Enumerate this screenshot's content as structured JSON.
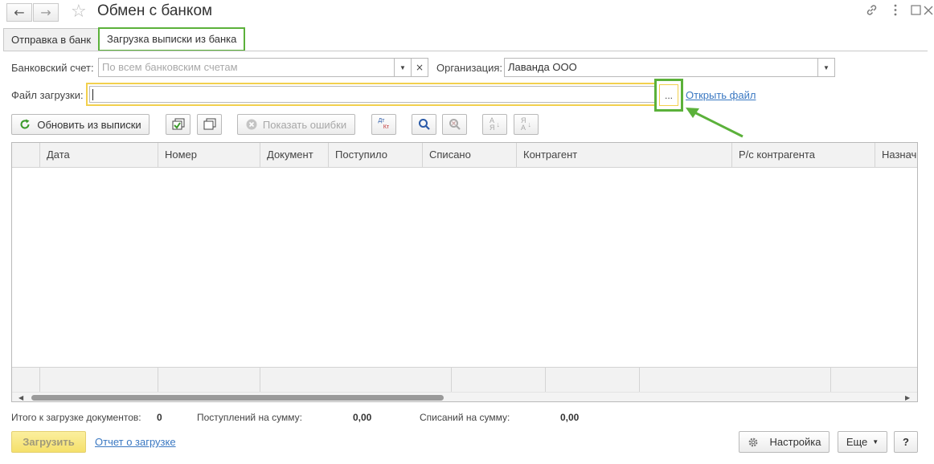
{
  "window": {
    "title": "Обмен с банком",
    "back_icon": "←",
    "forward_icon": "→",
    "favorite_icon": "☆",
    "link_icon": "🔗",
    "more_icon": "⋮",
    "maximize_icon": "□",
    "close_icon": "✕"
  },
  "tabs": [
    {
      "label": "Отправка в банк"
    },
    {
      "label": "Загрузка выписки из банка"
    }
  ],
  "form": {
    "bank_account_label": "Банковский счет:",
    "bank_account_placeholder": "По всем банковским счетам",
    "organization_label": "Организация:",
    "organization_value": "Лаванда ООО",
    "file_label": "Файл загрузки:",
    "file_value": "",
    "select_file_button": "...",
    "open_file_link": "Открыть файл",
    "dropdown_icon": "▼",
    "clear_icon": "×"
  },
  "toolbar": {
    "refresh_label": "Обновить из выписки",
    "show_errors_label": "Показать ошибки",
    "dt_kt_label_top": "Дт",
    "dt_kt_label_bottom": "Кт",
    "sort_asc_top": "А",
    "sort_asc_bottom": "Я",
    "sort_desc_top": "Я",
    "sort_desc_bottom": "А"
  },
  "table": {
    "columns": [
      "Дата",
      "Номер",
      "Документ",
      "Поступило",
      "Списано",
      "Контрагент",
      "Р/с контрагента",
      "Назначе"
    ],
    "rows": []
  },
  "totals": {
    "docs_label": "Итого к загрузке документов:",
    "docs_value": "0",
    "income_label": "Поступлений на сумму:",
    "income_value": "0,00",
    "outcome_label": "Списаний на сумму:",
    "outcome_value": "0,00"
  },
  "footer": {
    "load_button": "Загрузить",
    "report_link": "Отчет о загрузке",
    "settings_button": "Настройка",
    "more_button": "Еще",
    "help_button": "?"
  },
  "colors": {
    "highlight_green": "#5bb13a",
    "focus_yellow": "#f2d04d",
    "link_blue": "#3a78c2"
  }
}
